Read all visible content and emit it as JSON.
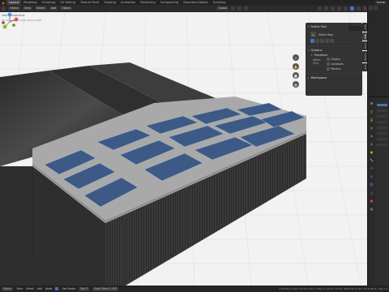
{
  "topbar": {
    "tabs": [
      "Layout",
      "Modeling",
      "Sculpting",
      "UV Editing",
      "Texture Paint",
      "Shading",
      "Animation",
      "Rendering",
      "Compositing",
      "Geometry Nodes",
      "Scripting"
    ],
    "active_tab": "Layout",
    "scene_label": "Scene"
  },
  "viewport_header": {
    "mode": "Object",
    "orientation": "Global",
    "menus": [
      "View",
      "Select",
      "Add",
      "Object"
    ]
  },
  "viewport": {
    "title": "User Perspective",
    "subtitle": "(0) Collection | Solar Panel 2.003",
    "options_label": "Options"
  },
  "tool_panel": {
    "active_tool_header": "Active Tool",
    "tool_name": "Select Box",
    "options_header": "Options",
    "transform_header": "Transform",
    "affect_only_label": "Affect Only",
    "affect_options": [
      "Origins",
      "Locations",
      "Parents"
    ],
    "workspace_header": "Workspace"
  },
  "side_tabs": [
    "Item",
    "Tool",
    "View",
    "Create",
    "Edit"
  ],
  "statusbar": {
    "mode": "Object",
    "menus": [
      "View",
      "Select",
      "Add",
      "Node"
    ],
    "use_nodes": "Use Nodes",
    "slot": "Slot 3",
    "material": "Solar Panel 2.003",
    "info": "4.Rooftop Solar Construction | Tube 3 | 2279 | 5175 | 4828 Faces 89 | Verts 89.8 | Obj 0.0"
  },
  "gizmo": {
    "axis_x": "X",
    "axis_y": "Y",
    "axis_z": "Z"
  },
  "colors": {
    "accent": "#4772b3",
    "orange": "#e87d0d",
    "axis_x": "#e44d5a",
    "axis_y": "#7fbf2f",
    "axis_z": "#4f8fe8"
  }
}
